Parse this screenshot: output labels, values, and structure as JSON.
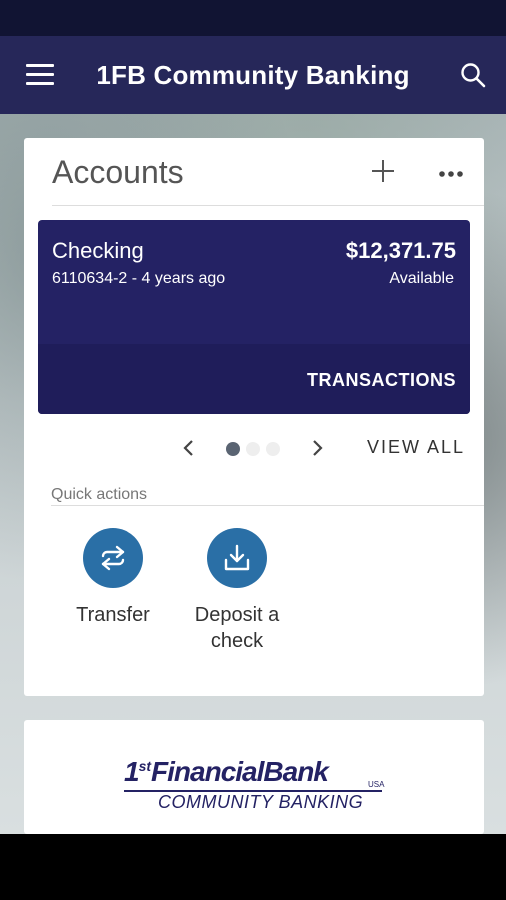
{
  "app": {
    "title": "1FB Community Banking"
  },
  "accounts_card": {
    "title": "Accounts",
    "accounts": [
      {
        "name": "Checking",
        "number_and_age": "6110634-2 - 4 years ago",
        "balance": "$12,371.75",
        "balance_label": "Available",
        "action_label": "TRANSACTIONS"
      }
    ],
    "pager": {
      "total_pages": 3,
      "active_page": 1,
      "view_all_label": "VIEW ALL"
    }
  },
  "quick_actions": {
    "label": "Quick actions",
    "items": [
      {
        "label": "Transfer",
        "icon": "transfer-arrows-icon"
      },
      {
        "label": "Deposit a check",
        "icon": "download-tray-icon"
      }
    ]
  },
  "logo": {
    "main_prefix": "1",
    "main_sup": "st",
    "main_rest": "FinancialBank",
    "usa": "USA",
    "sub": "COMMUNITY BANKING"
  },
  "colors": {
    "app_bar": "#262759",
    "status_bar": "#111433",
    "account_tile": "#242264",
    "quick_action": "#2a6fa6"
  }
}
